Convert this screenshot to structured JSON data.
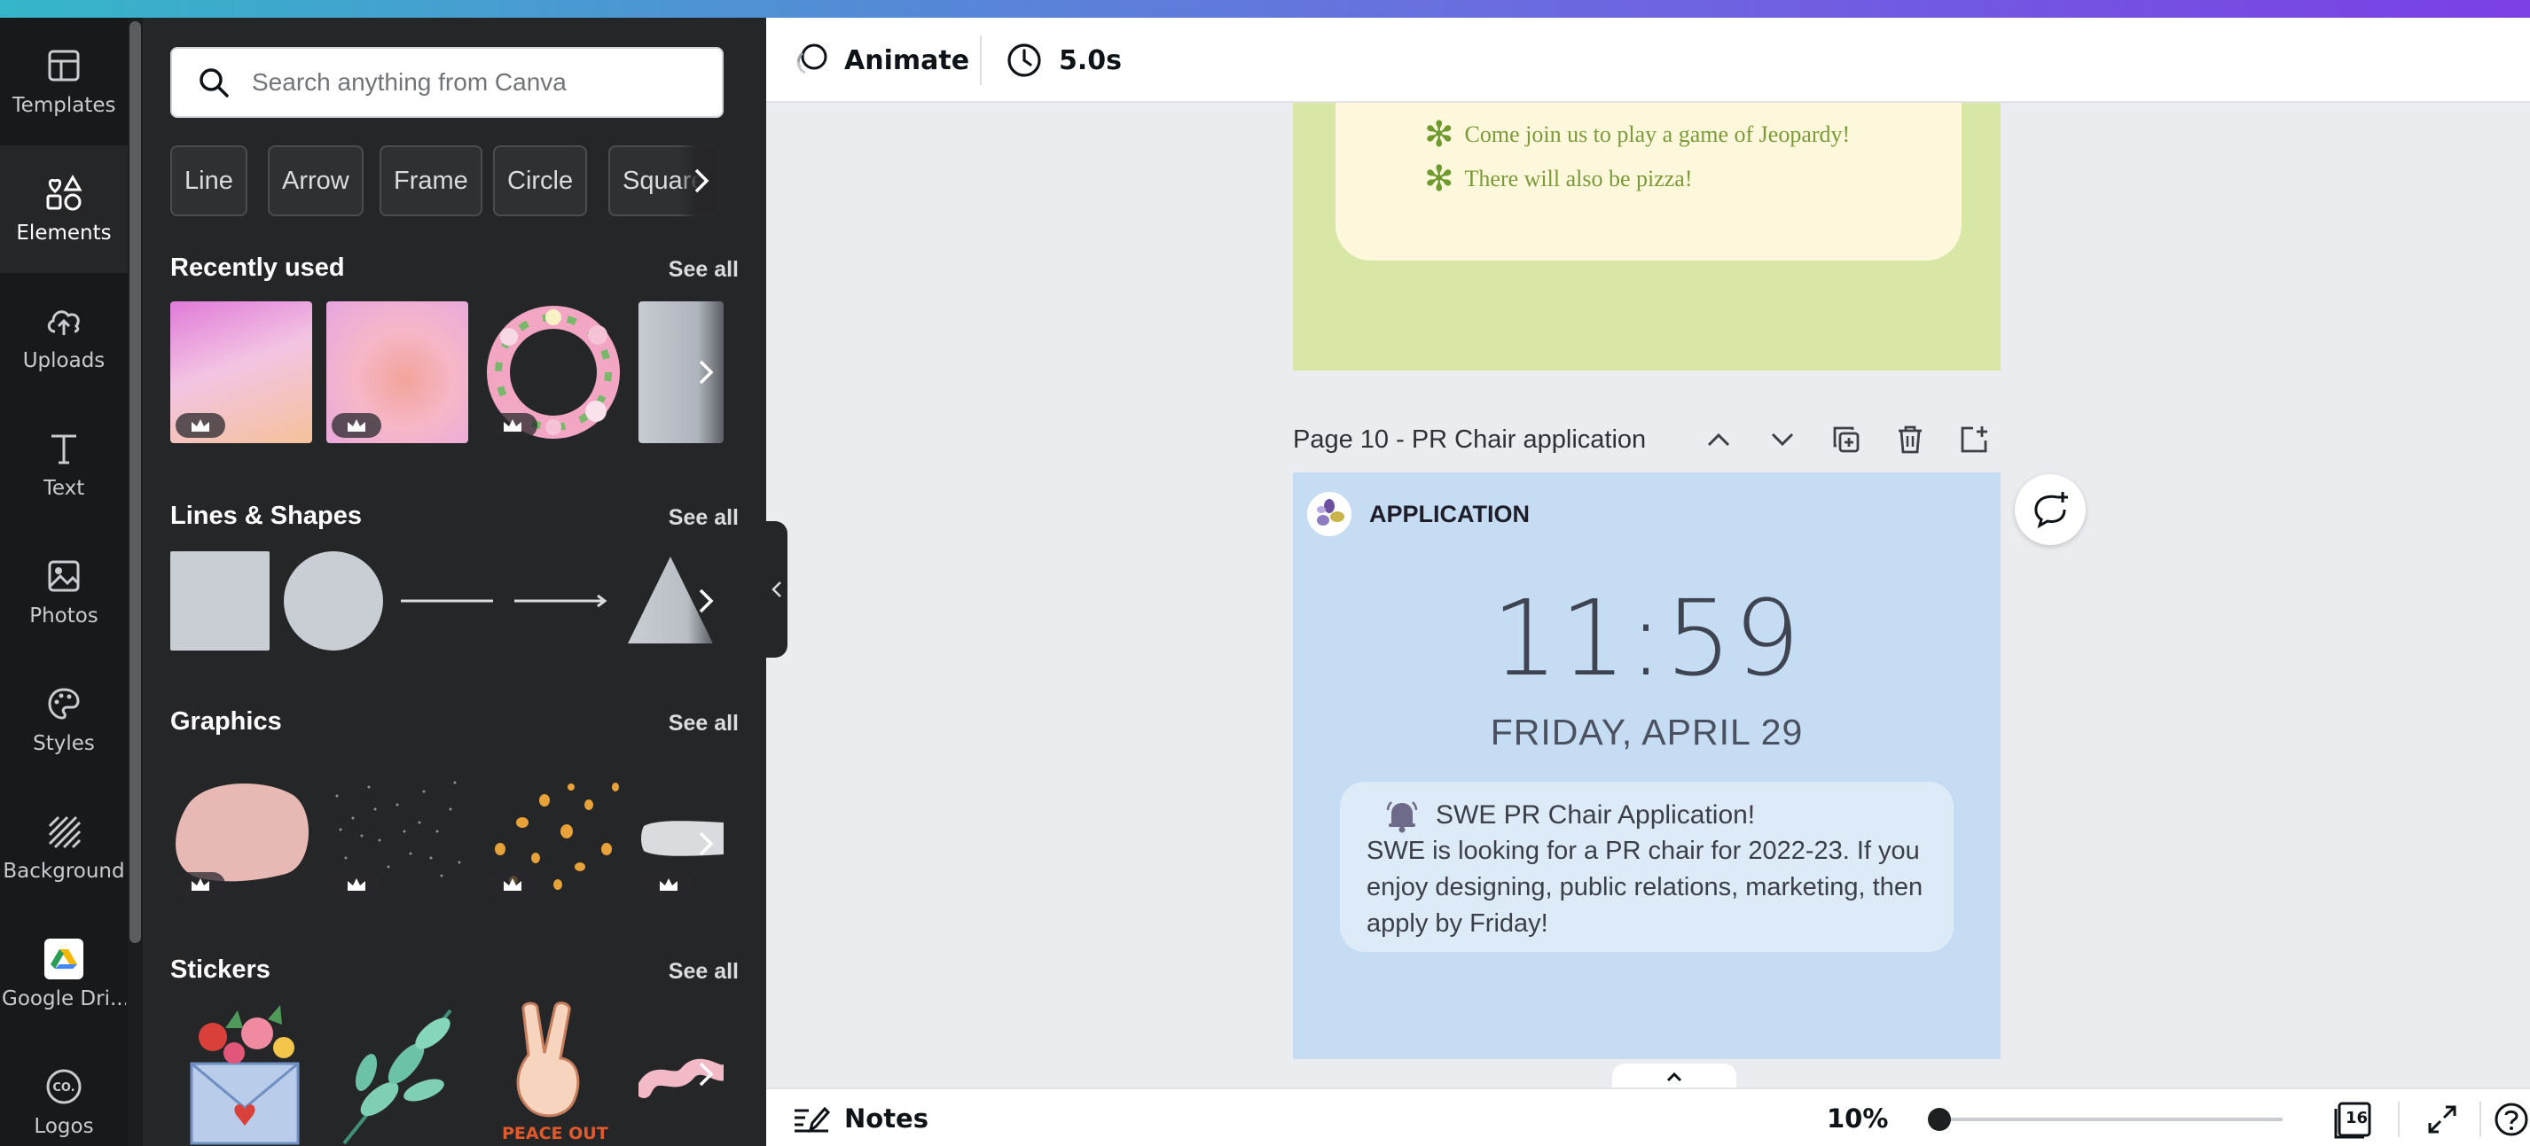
{
  "rail": {
    "items": [
      {
        "label": "Templates",
        "icon": "templates-icon"
      },
      {
        "label": "Elements",
        "icon": "elements-icon"
      },
      {
        "label": "Uploads",
        "icon": "uploads-icon"
      },
      {
        "label": "Text",
        "icon": "text-icon"
      },
      {
        "label": "Photos",
        "icon": "photos-icon"
      },
      {
        "label": "Styles",
        "icon": "styles-icon"
      },
      {
        "label": "Background",
        "icon": "background-icon"
      },
      {
        "label": "Google Dri...",
        "icon": "google-drive-icon"
      },
      {
        "label": "Logos",
        "icon": "logos-icon"
      }
    ],
    "active": "Elements"
  },
  "panel": {
    "search_placeholder": "Search anything from Canva",
    "chips": [
      "Line",
      "Arrow",
      "Frame",
      "Circle",
      "Square"
    ],
    "sections": {
      "recently_used": {
        "title": "Recently used",
        "see_all": "See all"
      },
      "lines_shapes": {
        "title": "Lines & Shapes",
        "see_all": "See all"
      },
      "graphics": {
        "title": "Graphics",
        "see_all": "See all"
      },
      "stickers": {
        "title": "Stickers",
        "see_all": "See all",
        "sticker_text": "PEACE OUT"
      }
    }
  },
  "toolbar": {
    "animate": "Animate",
    "duration": "5.0s"
  },
  "canvas": {
    "prev_page": {
      "bullets": [
        "Come join us to play a game of Jeopardy!",
        "There will also be pizza!"
      ]
    },
    "page10": {
      "title": "Page 10 - PR Chair application",
      "app_name": "APPLICATION",
      "time": "11:59",
      "date": "FRIDAY, APRIL 29",
      "notification_title": "SWE PR Chair Application!",
      "notification_body": "SWE is looking for a PR chair for 2022-23. If you enjoy designing, public relations, marketing, then apply by Friday!"
    }
  },
  "bottombar": {
    "notes": "Notes",
    "zoom": "10%",
    "zoom_fraction": 0.0,
    "page_count": "16"
  },
  "colors": {
    "rail_bg": "#18191b",
    "panel_bg": "#252627",
    "page10_bg": "#c5dcf2",
    "prev_page_bg": "#d8e6a6"
  }
}
